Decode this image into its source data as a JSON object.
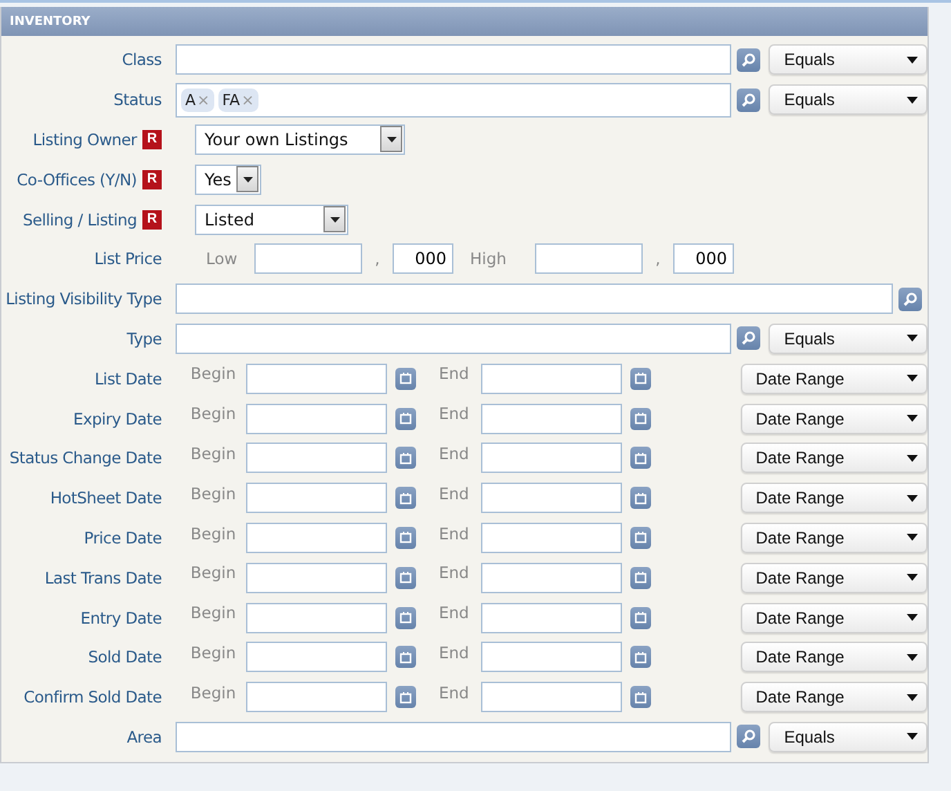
{
  "section": {
    "title": "INVENTORY"
  },
  "fields": [
    {
      "kind": "lookup",
      "label": "Class",
      "operator": "Equals"
    },
    {
      "kind": "tags",
      "label": "Status",
      "tags": [
        {
          "text": "A",
          "remove": "×"
        },
        {
          "text": "FA",
          "remove": "×"
        }
      ],
      "operator": "Equals"
    },
    {
      "kind": "select",
      "label": "Listing Owner",
      "badge": "R",
      "value": "Your own Listings"
    },
    {
      "kind": "select",
      "label": "Co-Offices (Y/N)",
      "badge": "R",
      "value": "Yes"
    },
    {
      "kind": "select",
      "label": "Selling / Listing",
      "badge": "R",
      "value": "Listed"
    },
    {
      "kind": "price",
      "label": "List Price",
      "low_label": "Low",
      "low_separator": ",",
      "low_thousands": "000",
      "high_label": "High",
      "high_separator": ",",
      "high_thousands": "000"
    },
    {
      "kind": "lookup",
      "label": "Listing Visibility Type"
    },
    {
      "kind": "lookup",
      "label": "Type",
      "operator": "Equals"
    },
    {
      "kind": "date",
      "label": "List Date",
      "begin_label": "Begin",
      "end_label": "End",
      "operator": "Date Range"
    },
    {
      "kind": "date",
      "label": "Expiry Date",
      "begin_label": "Begin",
      "end_label": "End",
      "operator": "Date Range"
    },
    {
      "kind": "date",
      "label": "Status Change Date",
      "begin_label": "Begin",
      "end_label": "End",
      "operator": "Date Range"
    },
    {
      "kind": "date",
      "label": "HotSheet Date",
      "begin_label": "Begin",
      "end_label": "End",
      "operator": "Date Range"
    },
    {
      "kind": "date",
      "label": "Price Date",
      "begin_label": "Begin",
      "end_label": "End",
      "operator": "Date Range"
    },
    {
      "kind": "date",
      "label": "Last Trans Date",
      "begin_label": "Begin",
      "end_label": "End",
      "operator": "Date Range"
    },
    {
      "kind": "date",
      "label": "Entry Date",
      "begin_label": "Begin",
      "end_label": "End",
      "operator": "Date Range"
    },
    {
      "kind": "date",
      "label": "Sold Date",
      "begin_label": "Begin",
      "end_label": "End",
      "operator": "Date Range"
    },
    {
      "kind": "date",
      "label": "Confirm Sold Date",
      "begin_label": "Begin",
      "end_label": "End",
      "operator": "Date Range"
    },
    {
      "kind": "lookup",
      "label": "Area",
      "operator": "Equals"
    }
  ]
}
